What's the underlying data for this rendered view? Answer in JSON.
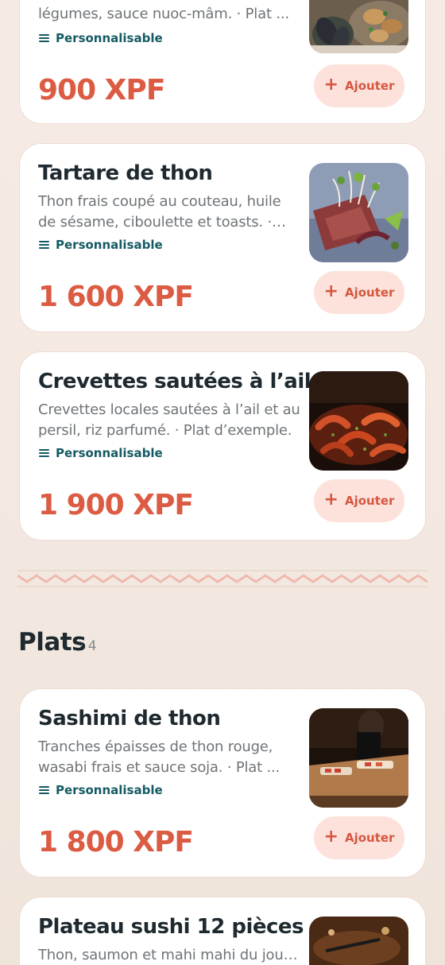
{
  "items": [
    {
      "title": "",
      "description": "légumes, sauce nuoc-mâm. · Plat ...",
      "tag": "Personnalisable",
      "price": "900 XPF",
      "add_label": "Ajouter",
      "image": "dumplings-and-eggplant-photo"
    },
    {
      "title": "Tartare de thon",
      "description": "Thon frais coupé au couteau, huile de sésame, ciboulette et toasts. · Plat ...",
      "tag": "Personnalisable",
      "price": "1 600 XPF",
      "add_label": "Ajouter",
      "image": "tuna-tartare-photo"
    },
    {
      "title": "Crevettes sautées à l’ail",
      "description": "Crevettes locales sautées à l’ail et au persil, riz parfumé. · Plat d’exemple.",
      "tag": "Personnalisable",
      "price": "1 900 XPF",
      "add_label": "Ajouter",
      "image": "garlic-shrimp-photo"
    },
    {
      "title": "Sashimi de thon",
      "description": "Tranches épaisses de thon rouge, wasabi frais et sauce soja. · Plat ...",
      "tag": "Personnalisable",
      "price": "1 800 XPF",
      "add_label": "Ajouter",
      "image": "sashimi-counter-photo"
    },
    {
      "title": "Plateau sushi 12 pièces",
      "description": "Thon, saumon et mahi mahi du jour, riz",
      "tag": "",
      "price": "",
      "add_label": "",
      "image": "sushi-platter-photo"
    }
  ],
  "section": {
    "title": "Plats",
    "count": "· 4"
  },
  "colors": {
    "price": "#dc5b43",
    "accent_bg": "#fde2dc",
    "tag": "#155a63",
    "divider": "#f0b9ad"
  }
}
